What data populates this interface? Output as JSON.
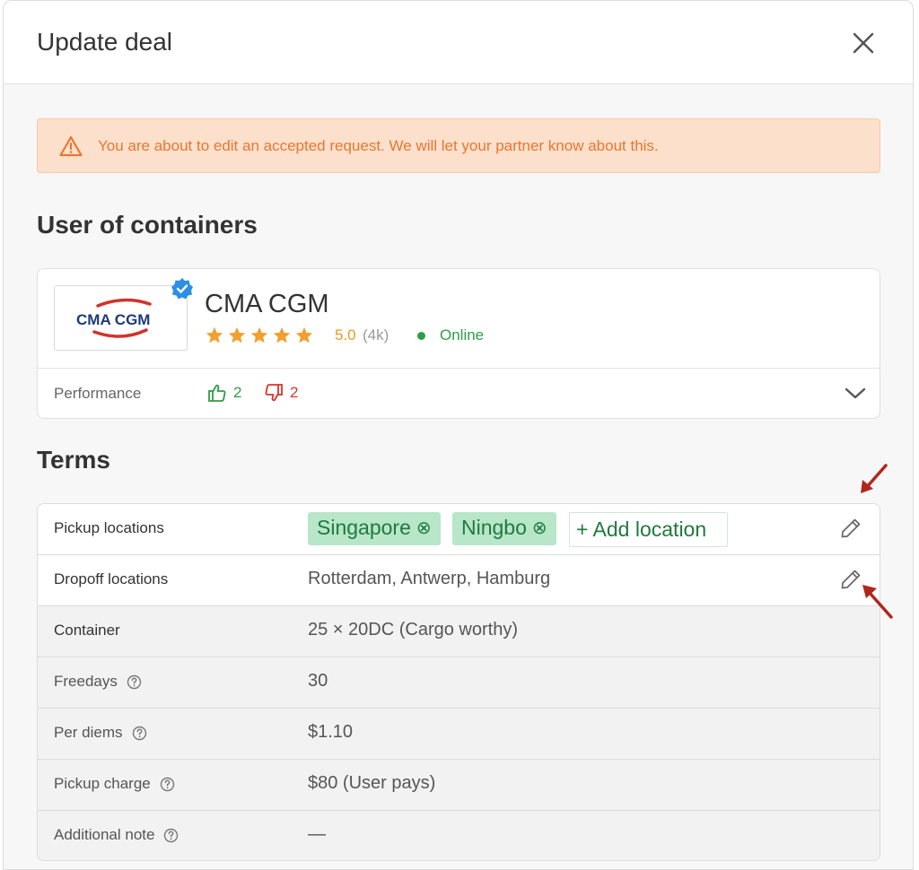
{
  "modal": {
    "title": "Update deal"
  },
  "alert": {
    "text": "You are about to edit an accepted request. We will let your partner know about this."
  },
  "partner_section": {
    "title": "User of containers",
    "company": {
      "logo_text": "CMA CGM",
      "name": "CMA CGM",
      "rating": "5.0",
      "rating_count": "(4k)",
      "stars": 5,
      "status": "Online"
    },
    "performance": {
      "label": "Performance",
      "thumbs_up": "2",
      "thumbs_down": "2"
    }
  },
  "terms": {
    "title": "Terms",
    "pickup": {
      "label": "Pickup locations",
      "chips": [
        {
          "label": "Singapore"
        },
        {
          "label": "Ningbo"
        }
      ],
      "chip_remove_glyph": "⊗",
      "add_label": "+ Add location"
    },
    "dropoff": {
      "label": "Dropoff locations",
      "value": "Rotterdam, Antwerp, Hamburg"
    },
    "container": {
      "label": "Container",
      "value": "25 × 20DC (Cargo worthy)"
    },
    "freedays": {
      "label": "Freedays",
      "value": "30"
    },
    "per_diems": {
      "label": "Per diems",
      "value": "$1.10"
    },
    "pickup_charge": {
      "label": "Pickup charge",
      "value": "$80 (User pays)"
    },
    "additional_note": {
      "label": "Additional note",
      "value": "—"
    }
  },
  "colors": {
    "alert_bg": "#fde0cc",
    "alert_text": "#e8772e",
    "chip_bg": "#b8e6c8",
    "chip_text": "#1f7a3f",
    "online_green": "#2e9e46",
    "negative_red": "#d9342b",
    "star_orange": "#f0a030",
    "verified_blue": "#2b8fe6",
    "annotation_arrow": "#b0271e"
  }
}
